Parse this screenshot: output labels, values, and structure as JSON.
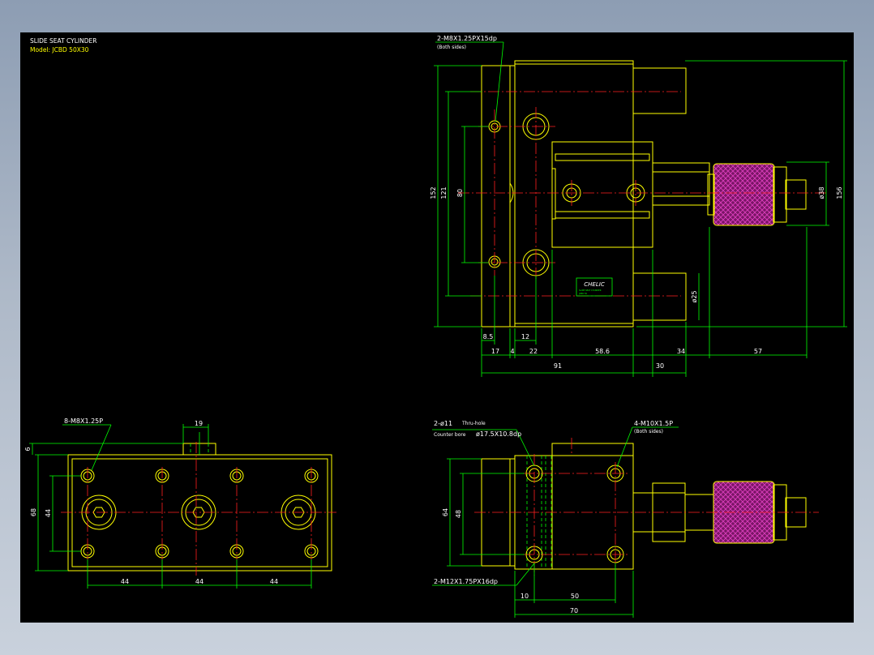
{
  "title": {
    "line1": "SLIDE SEAT CYLINDER",
    "line2": "Model: JCBD 50X30"
  },
  "top_view": {
    "callout_hole": "2-M8X1.25PX15dp",
    "callout_hole_note": "(Both sides)",
    "dim_152": "152",
    "dim_121": "121",
    "dim_80": "80",
    "dim_156": "156",
    "dim_d38": "ø38",
    "dim_d25": "ø25",
    "dim_8_5": "8.5",
    "dim_12": "12",
    "dim_17": "17",
    "dim_4": "4",
    "dim_22": "22",
    "dim_58_6": "58.6",
    "dim_34": "34",
    "dim_57": "57",
    "dim_91": "91",
    "dim_30": "30",
    "logo_text": "CHELIC",
    "logo_sub1": "SLIDE SEAT CYLINDER",
    "logo_sub2": "JCBD 50"
  },
  "left_view": {
    "callout_hole": "8-M8X1.25P",
    "dim_19": "19",
    "dim_6": "6",
    "dim_68": "68",
    "dim_44v": "44",
    "dim_44a": "44",
    "dim_44b": "44",
    "dim_44c": "44"
  },
  "front_view": {
    "callout_thru": "2-ø11",
    "callout_thru_note": "Thru-hole",
    "callout_cbore_label": "Counter bore",
    "callout_cbore": "ø17.5X10.8dp",
    "callout_tap": "4-M10X1.5P",
    "callout_tap_note": "(Both sides)",
    "callout_bottom": "2-M12X1.75PX16dp",
    "dim_64": "64",
    "dim_48": "48",
    "dim_10": "10",
    "dim_50": "50",
    "dim_70": "70"
  },
  "colors": {
    "background": "#000000",
    "outline": "#ffff00",
    "dimension": "#00ff00",
    "centerline": "#ff2020",
    "text": "#ffffff",
    "knurl": "#b0208a"
  }
}
